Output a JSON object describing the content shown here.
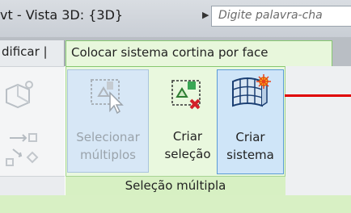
{
  "window": {
    "title": "vt - Vista 3D: {3D}",
    "search_placeholder": "Digite palavra-cha"
  },
  "tabs": {
    "modify_label": "dificar |",
    "context_label": "Colocar sistema cortina por face"
  },
  "ribbon": {
    "panel_label": "Seleção múltipla",
    "buttons": [
      {
        "line1": "Selecionar",
        "line2": "múltiplos",
        "enabled": false,
        "icon": "select-multiple-icon"
      },
      {
        "line1": "Criar",
        "line2": "seleção",
        "enabled": true,
        "icon": "create-selection-icon"
      },
      {
        "line1": "Criar",
        "line2": "sistema",
        "enabled": true,
        "icon": "create-system-icon"
      }
    ]
  },
  "colors": {
    "context_tab_bg": "#e8f7dc",
    "context_tab_border": "#86c86f",
    "active_button_border": "#5b9bd5",
    "annotation_line": "#e00000"
  }
}
